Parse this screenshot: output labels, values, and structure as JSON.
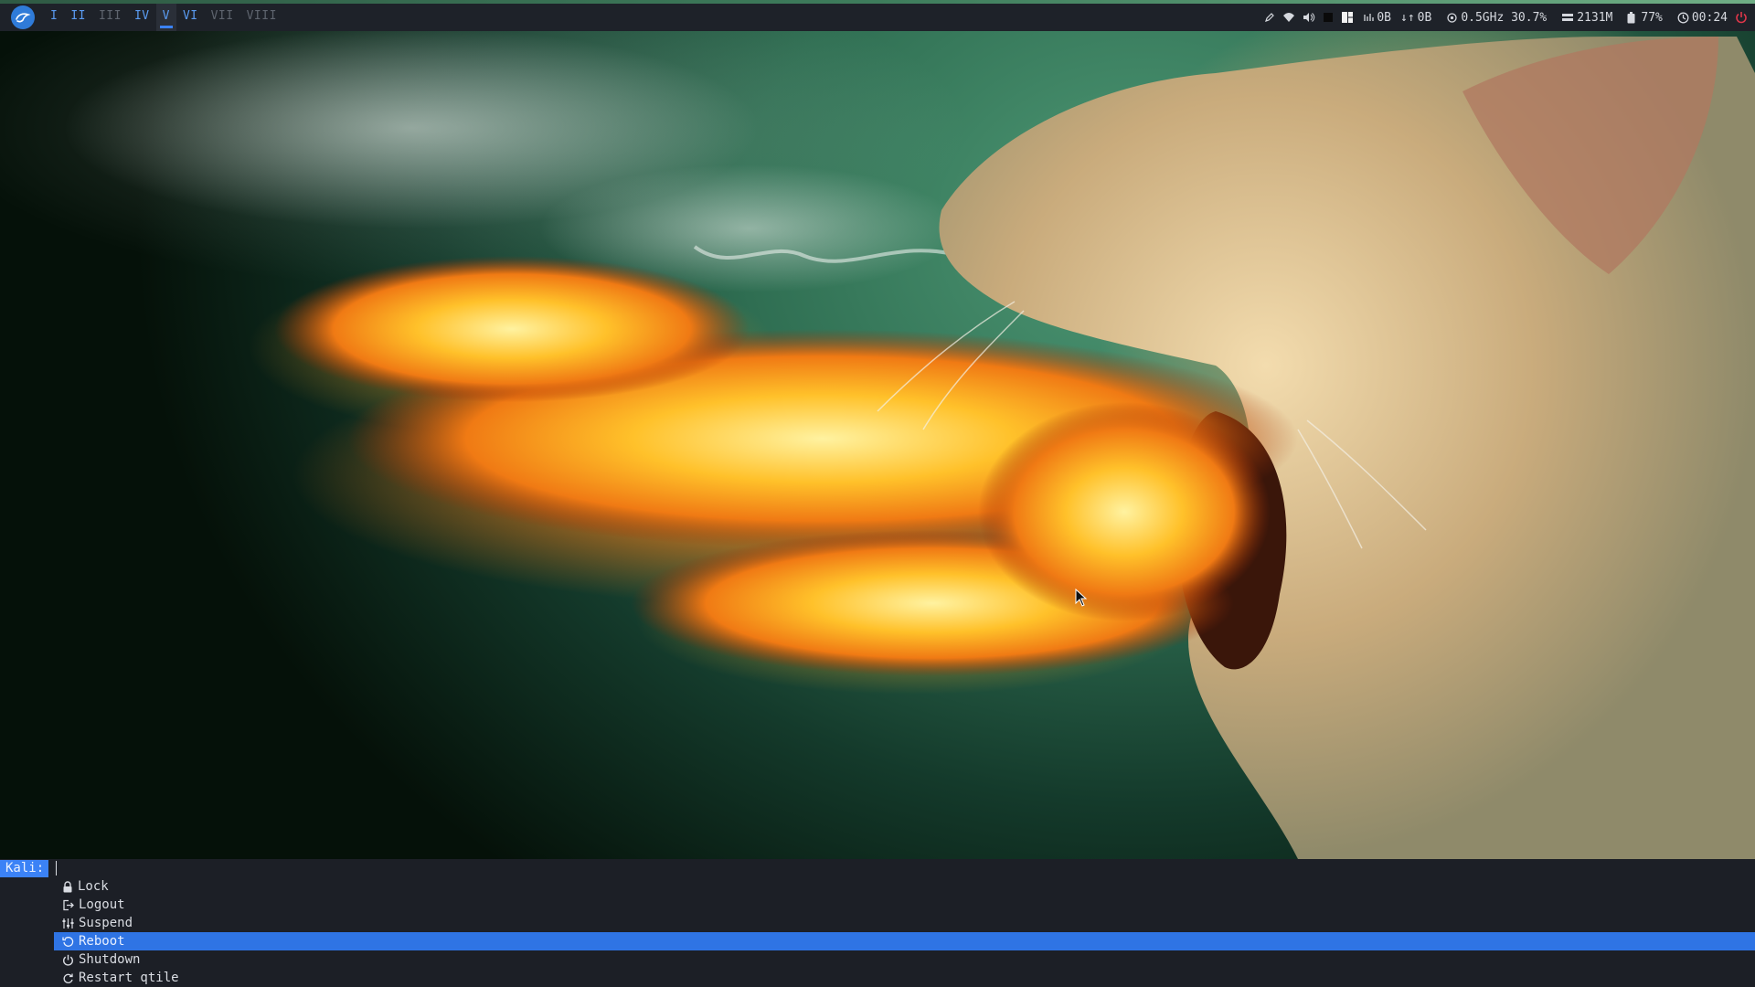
{
  "topbar": {
    "logo_icon": "kali-dragon-icon",
    "groups": [
      {
        "label": "I",
        "state": "active"
      },
      {
        "label": "II",
        "state": "active"
      },
      {
        "label": "III",
        "state": "inactive"
      },
      {
        "label": "IV",
        "state": "active"
      },
      {
        "label": "V",
        "state": "current"
      },
      {
        "label": "VI",
        "state": "active"
      },
      {
        "label": "VII",
        "state": "inactive"
      },
      {
        "label": "VIII",
        "state": "inactive"
      }
    ],
    "status": {
      "net_down": "0B",
      "net_up": "0B",
      "cpu": "0.5GHz 30.7%",
      "memory": "2131M",
      "battery": "77%",
      "clock": "00:24"
    },
    "icons": [
      "pencil-icon",
      "wifi-icon",
      "volume-icon",
      "black-square-icon",
      "layout-icon",
      "network-icon",
      "cpu-icon",
      "memory-icon",
      "battery-icon",
      "clock-icon",
      "power-icon"
    ],
    "colors": {
      "bar_bg": "#1e2229",
      "group_active": "#5a9bf0",
      "group_inactive": "#5e646e",
      "power_icon": "#e0364a"
    }
  },
  "prompt": {
    "label": "Kali:",
    "value": "",
    "menu": [
      {
        "icon": "lock-icon",
        "label": "Lock",
        "selected": false
      },
      {
        "icon": "logout-icon",
        "label": "Logout",
        "selected": false
      },
      {
        "icon": "suspend-icon",
        "label": "Suspend",
        "selected": false
      },
      {
        "icon": "reboot-icon",
        "label": "Reboot",
        "selected": true
      },
      {
        "icon": "shutdown-icon",
        "label": "Shutdown",
        "selected": false
      },
      {
        "icon": "restart-icon",
        "label": "Restart qtile",
        "selected": false
      }
    ],
    "colors": {
      "selected_bg": "#2f74e4",
      "label_bg": "#3b82f6"
    }
  },
  "wallpaper": {
    "subject": "cat breathing fire"
  }
}
